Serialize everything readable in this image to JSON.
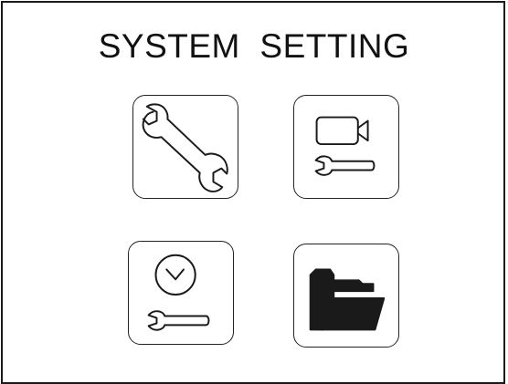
{
  "screen": {
    "title": "SYSTEM  SETTING"
  },
  "tiles": [
    {
      "name": "general-settings",
      "icon": "wrench-icon"
    },
    {
      "name": "camera-settings",
      "icon": "camera-wrench-icon"
    },
    {
      "name": "time-settings",
      "icon": "clock-wrench-icon"
    },
    {
      "name": "file-settings",
      "icon": "folder-icon"
    }
  ],
  "colors": {
    "stroke": "#1a1a1a",
    "background": "#ffffff"
  }
}
